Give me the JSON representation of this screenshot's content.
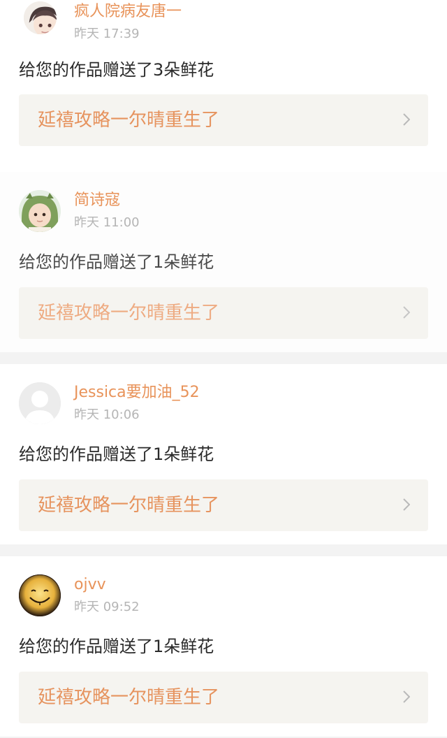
{
  "notifications": [
    {
      "username": "疯人院病友唐一",
      "time": "昨天 17:39",
      "message": "给您的作品赠送了3朵鲜花",
      "work_title": "延禧攻略一尔晴重生了",
      "avatar_icon": "anime-boy-avatar-icon"
    },
    {
      "username": "简诗寇",
      "time": "昨天 11:00",
      "message": "给您的作品赠送了1朵鲜花",
      "work_title": "延禧攻略一尔晴重生了",
      "avatar_icon": "child-in-dinosaur-hood-avatar-icon"
    },
    {
      "username": "Jessica要加油_52",
      "time": "昨天 10:06",
      "message": "给您的作品赠送了1朵鲜花",
      "work_title": "延禧攻略一尔晴重生了",
      "avatar_icon": "default-user-avatar-icon"
    },
    {
      "username": "ojvv",
      "time": "昨天 09:52",
      "message": "给您的作品赠送了1朵鲜花",
      "work_title": "延禧攻略一尔晴重生了",
      "avatar_icon": "smiley-face-avatar-icon"
    }
  ],
  "colors": {
    "username": "#e8935a",
    "work_title": "#e6935e",
    "time": "#b5b5b5",
    "message": "#2a2a2a",
    "work_link_background": "#f5f4f0",
    "separator": "#f3f3f3"
  }
}
